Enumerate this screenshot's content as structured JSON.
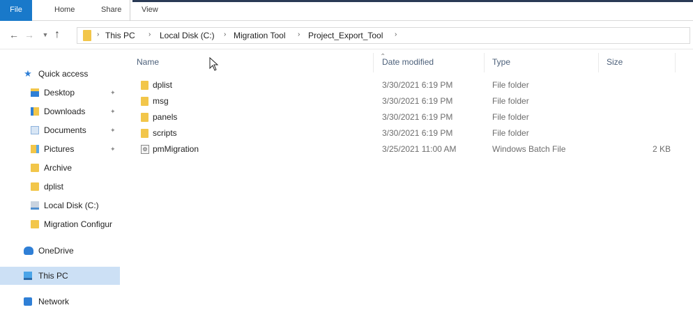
{
  "ribbon": {
    "tabs": [
      {
        "label": "File"
      },
      {
        "label": "Home"
      },
      {
        "label": "Share"
      },
      {
        "label": "View"
      }
    ],
    "accent": "#1979ca"
  },
  "address": {
    "crumbs": [
      "This PC",
      "Local Disk (C:)",
      "Migration Tool",
      "Project_Export_Tool"
    ]
  },
  "sidebar": {
    "items": [
      {
        "label": "Quick access",
        "icon": "star-icon"
      },
      {
        "label": "Desktop",
        "icon": "desktop-icon",
        "pinned": true
      },
      {
        "label": "Downloads",
        "icon": "downloads-icon",
        "pinned": true
      },
      {
        "label": "Documents",
        "icon": "documents-icon",
        "pinned": true
      },
      {
        "label": "Pictures",
        "icon": "pictures-icon",
        "pinned": true
      },
      {
        "label": "Archive",
        "icon": "folder-icon"
      },
      {
        "label": "dplist",
        "icon": "folder-icon"
      },
      {
        "label": "Local Disk (C:)",
        "icon": "disk-icon"
      },
      {
        "label": "Migration Configur",
        "icon": "folder-icon"
      },
      {
        "label": "OneDrive",
        "icon": "onedrive-icon"
      },
      {
        "label": "This PC",
        "icon": "this-pc-icon",
        "selected": true
      },
      {
        "label": "Network",
        "icon": "network-icon"
      }
    ],
    "selected_color": "#cce0f5"
  },
  "columns": {
    "name": "Name",
    "date": "Date modified",
    "type": "Type",
    "size": "Size"
  },
  "files": [
    {
      "name": "dplist",
      "date": "3/30/2021 6:19 PM",
      "type": "File folder",
      "size": "",
      "icon": "folder-icon"
    },
    {
      "name": "msg",
      "date": "3/30/2021 6:19 PM",
      "type": "File folder",
      "size": "",
      "icon": "folder-icon"
    },
    {
      "name": "panels",
      "date": "3/30/2021 6:19 PM",
      "type": "File folder",
      "size": "",
      "icon": "folder-icon"
    },
    {
      "name": "scripts",
      "date": "3/30/2021 6:19 PM",
      "type": "File folder",
      "size": "",
      "icon": "folder-icon"
    },
    {
      "name": "pmMigration",
      "date": "3/25/2021 11:00 AM",
      "type": "Windows Batch File",
      "size": "2 KB",
      "icon": "batch-file-icon"
    }
  ]
}
